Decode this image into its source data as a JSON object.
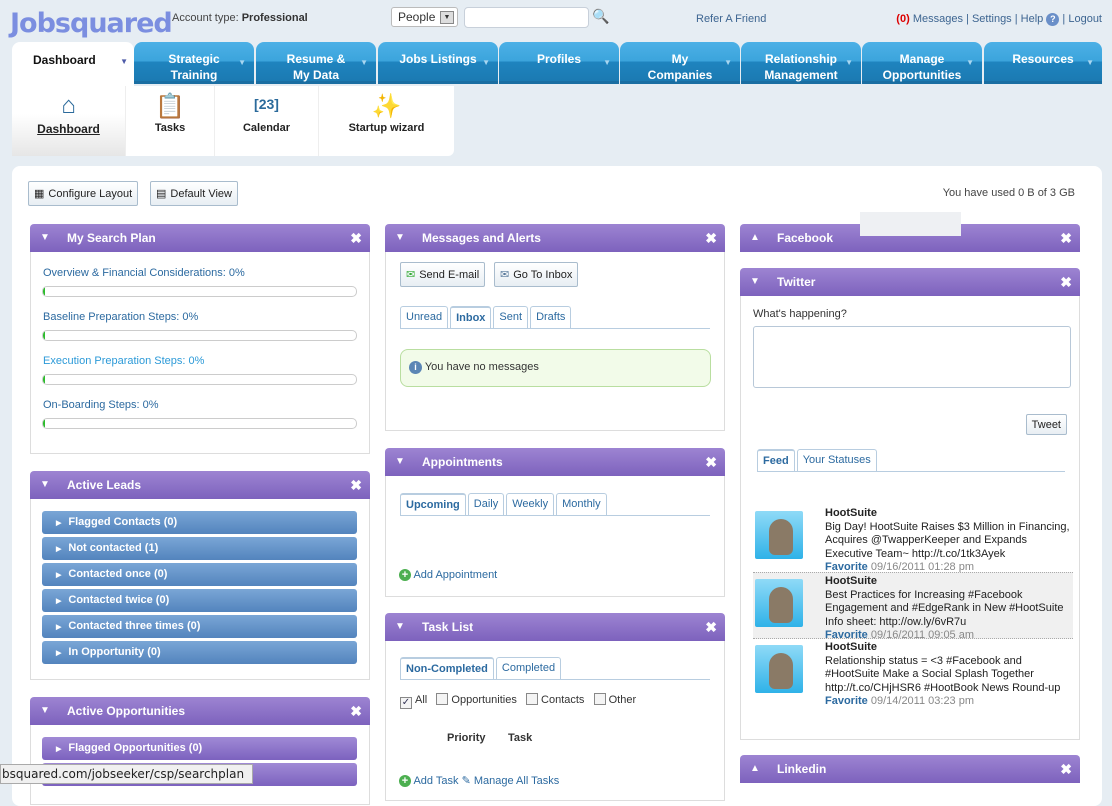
{
  "header": {
    "logo": "Jobsquared",
    "account_label": "Account type:",
    "account_type": "Professional",
    "search_scope": "People",
    "search_value": "",
    "refer": "Refer A Friend",
    "msg_count": "(0)",
    "messages": "Messages",
    "settings": "Settings",
    "help": "Help",
    "logout": "Logout",
    "sep": "|"
  },
  "nav": [
    {
      "l1": "Dashboard",
      "l2": ""
    },
    {
      "l1": "Strategic",
      "l2": "Training"
    },
    {
      "l1": "Resume &",
      "l2": "My Data"
    },
    {
      "l1": "Jobs Listings",
      "l2": ""
    },
    {
      "l1": "Profiles",
      "l2": ""
    },
    {
      "l1": "My",
      "l2": "Companies"
    },
    {
      "l1": "Relationship",
      "l2": "Management"
    },
    {
      "l1": "Manage",
      "l2": "Opportunities"
    },
    {
      "l1": "Resources",
      "l2": ""
    }
  ],
  "subnav": [
    "Dashboard",
    "Tasks",
    "Calendar",
    "Startup wizard"
  ],
  "toolbar": {
    "configure": "Configure Layout",
    "default_view": "Default View",
    "usage": "You have used 0 B of 3 GB"
  },
  "search_plan": {
    "title": "My Search Plan",
    "items": [
      {
        "label": "Overview & Financial Considerations: 0%",
        "progress": 0
      },
      {
        "label": "Baseline Preparation Steps: 0%",
        "progress": 0
      },
      {
        "label": "Execution Preparation Steps: 0%",
        "progress": 0
      },
      {
        "label": "On-Boarding Steps: 0%",
        "progress": 0
      }
    ]
  },
  "active_leads": {
    "title": "Active Leads",
    "items": [
      "Flagged Contacts (0)",
      "Not contacted (1)",
      "Contacted once (0)",
      "Contacted twice (0)",
      "Contacted three times (0)",
      "In Opportunity (0)"
    ]
  },
  "active_opps": {
    "title": "Active Opportunities",
    "items": [
      "Flagged Opportunities (0)"
    ]
  },
  "messages": {
    "title": "Messages and Alerts",
    "send": "Send E-mail",
    "inbox_btn": "Go To Inbox",
    "tabs": [
      "Unread",
      "Inbox",
      "Sent",
      "Drafts"
    ],
    "empty": "You have no messages"
  },
  "appointments": {
    "title": "Appointments",
    "tabs": [
      "Upcoming",
      "Daily",
      "Weekly",
      "Monthly"
    ],
    "add": "Add Appointment"
  },
  "tasks": {
    "title": "Task List",
    "tabs": [
      "Non-Completed",
      "Completed"
    ],
    "filters": [
      "All",
      "Opportunities",
      "Contacts",
      "Other"
    ],
    "col_priority": "Priority",
    "col_task": "Task",
    "add": "Add Task",
    "manage": "Manage All Tasks"
  },
  "facebook": {
    "title": "Facebook"
  },
  "twitter": {
    "title": "Twitter",
    "prompt": "What's happening?",
    "tweet": "Tweet",
    "tabs": [
      "Feed",
      "Your Statuses"
    ],
    "tweets": [
      {
        "user": "HootSuite",
        "text": "Big Day! HootSuite Raises $3 Million in Financing, Acquires @TwapperKeeper and Expands Executive Team~ http://t.co/1tk3Ayek",
        "fav": "Favorite",
        "date": "09/16/2011 01:28 pm"
      },
      {
        "user": "HootSuite",
        "text": "Best Practices for Increasing #Facebook Engagement and #EdgeRank in New #HootSuite Info sheet: http://ow.ly/6vR7u",
        "fav": "Favorite",
        "date": "09/16/2011 09:05 am"
      },
      {
        "user": "HootSuite",
        "text": "Relationship status = <3 #Facebook and #HootSuite Make a Social Splash Together http://t.co/CHjHSR6 #HootBook News Round-up",
        "fav": "Favorite",
        "date": "09/14/2011 03:23 pm"
      }
    ]
  },
  "linkedin": {
    "title": "Linkedin"
  },
  "statusbar": "bsquared.com/jobseeker/csp/searchplan"
}
